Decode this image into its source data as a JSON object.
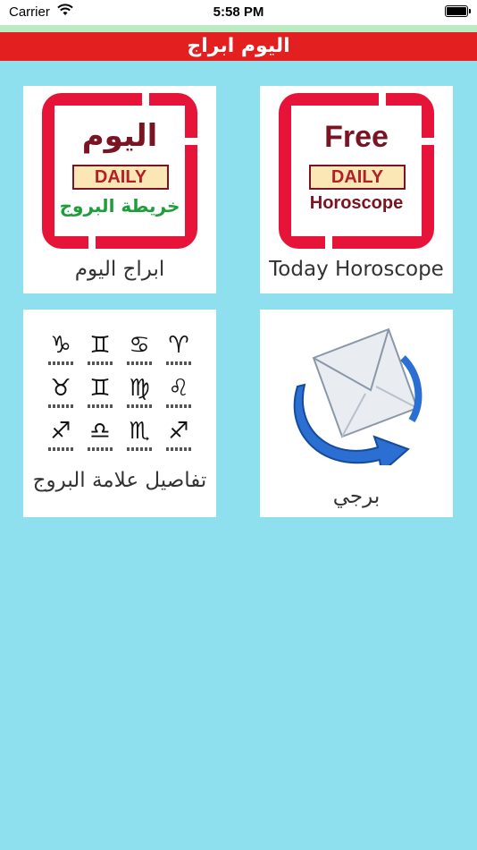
{
  "status_bar": {
    "carrier": "Carrier",
    "time": "5:58 PM"
  },
  "header": {
    "title": "اليوم ابراج"
  },
  "cards": [
    {
      "label": "Today Horoscope",
      "logo": {
        "top": "Free",
        "badge": "DAILY",
        "bottom": "Horoscope"
      }
    },
    {
      "label": "ابراج اليوم",
      "logo": {
        "top": "اليوم",
        "badge": "DAILY",
        "bottom": "خريطة البروج"
      }
    },
    {
      "label": "برجي",
      "icon": "mail-refresh-icon"
    },
    {
      "label": "تفاصيل علامة البروج",
      "icon": "zodiac-signs-icon",
      "signs": [
        "♑",
        "♊",
        "♋",
        "♈",
        "♉",
        "♊",
        "♍",
        "♌",
        "♐",
        "♎",
        "♏",
        "♐"
      ]
    }
  ],
  "colors": {
    "background": "#8ee0ee",
    "header_bar": "#e31f1f",
    "logo_red": "#e7143a"
  }
}
